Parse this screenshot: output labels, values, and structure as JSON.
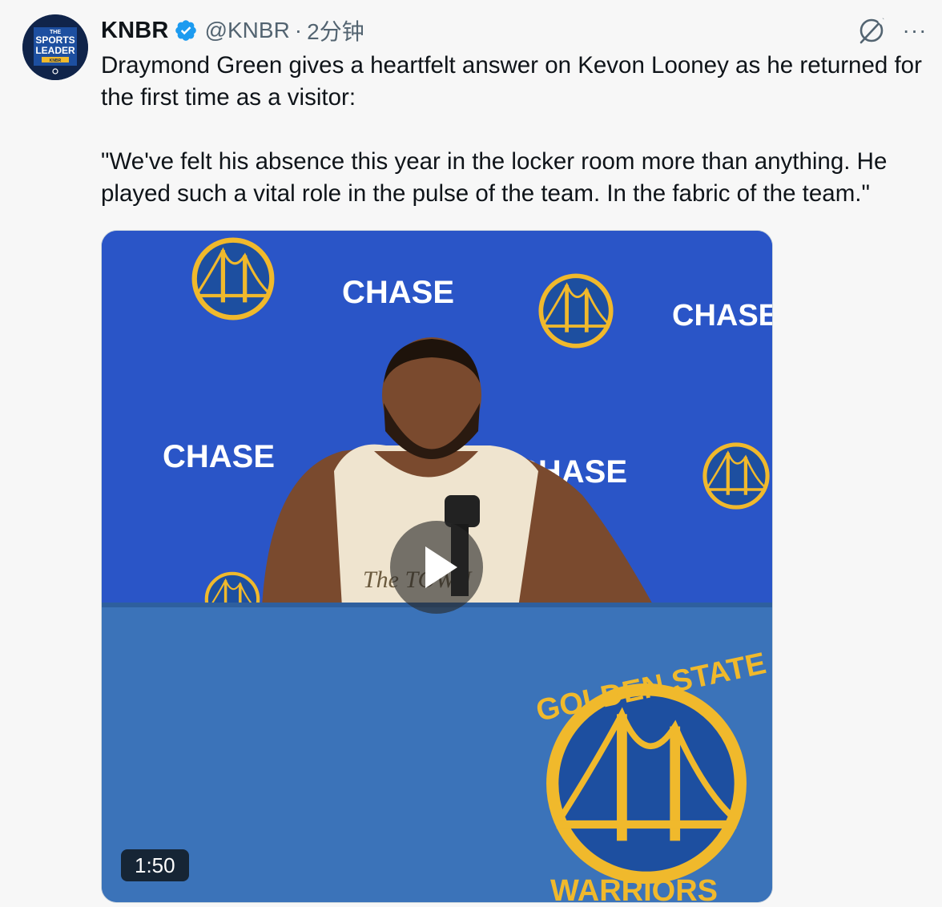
{
  "author": {
    "avatar_icon": "knbr-sports-leader-logo",
    "avatar_lines": [
      "THE",
      "SPORTS",
      "LEADER",
      "KNBR"
    ],
    "name": "KNBR",
    "verified_icon": "verified-badge-icon",
    "handle": "@KNBR",
    "separator": "·",
    "time": "2分钟"
  },
  "actions": {
    "grok_icon": "grok-icon",
    "more_label": "···"
  },
  "tweet": {
    "text": "Draymond Green gives a heartfelt answer on Kevon Looney as he returned for the first time as a visitor:\n\n\"We've felt his absence this year in the locker room more than anything. He played such a vital role in the pulse of the team. In the fabric of the team.\""
  },
  "media": {
    "backdrop_text": "CHASE",
    "logo_text_top": "GOLDEN STATE",
    "logo_text_bottom": "WARRIORS",
    "jersey_text": "The TOWN",
    "play_icon": "play-icon",
    "duration": "1:50",
    "colors": {
      "backdrop": "#2a55c7",
      "table": "#3b73b9",
      "gold": "#f0b92c"
    }
  }
}
